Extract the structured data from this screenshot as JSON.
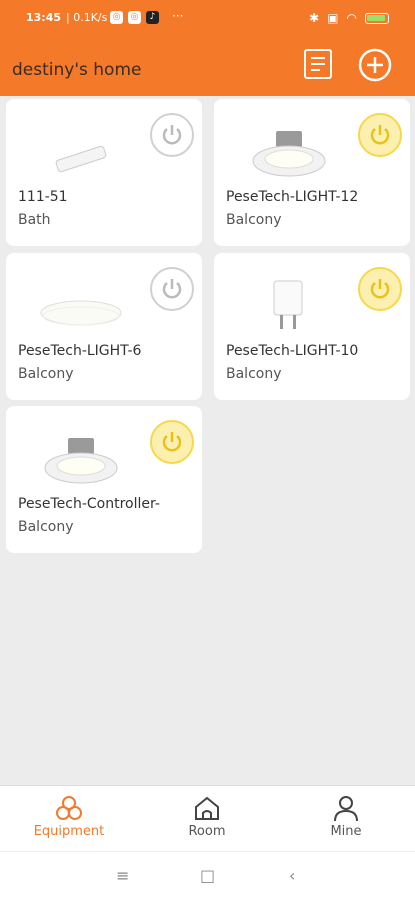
{
  "status_bar": {
    "time": "13:45",
    "speed": "| 0.1K/s",
    "more": "···"
  },
  "header": {
    "title": "destiny's home",
    "list_icon": "list-icon",
    "add_icon": "add-icon"
  },
  "devices": [
    {
      "name": "111-51",
      "room": "Bath",
      "on": false,
      "image": "light-strip-controller"
    },
    {
      "name": "PeseTech-LIGHT-12",
      "room": "Balcony",
      "on": true,
      "image": "downlight"
    },
    {
      "name": "PeseTech-LIGHT-6",
      "room": "Balcony",
      "on": false,
      "image": "panel-light"
    },
    {
      "name": "PeseTech-LIGHT-10",
      "room": "Balcony",
      "on": true,
      "image": "smart-plug"
    },
    {
      "name": "PeseTech-Controller-",
      "room": "Balcony",
      "on": true,
      "image": "downlight"
    }
  ],
  "tabs": [
    {
      "label": "Equipment",
      "icon": "equipment-icon",
      "active": true
    },
    {
      "label": "Room",
      "icon": "room-icon",
      "active": false
    },
    {
      "label": "Mine",
      "icon": "person-icon",
      "active": false
    }
  ],
  "colors": {
    "accent": "#f47a2a",
    "power_on": "#f6d84a"
  }
}
